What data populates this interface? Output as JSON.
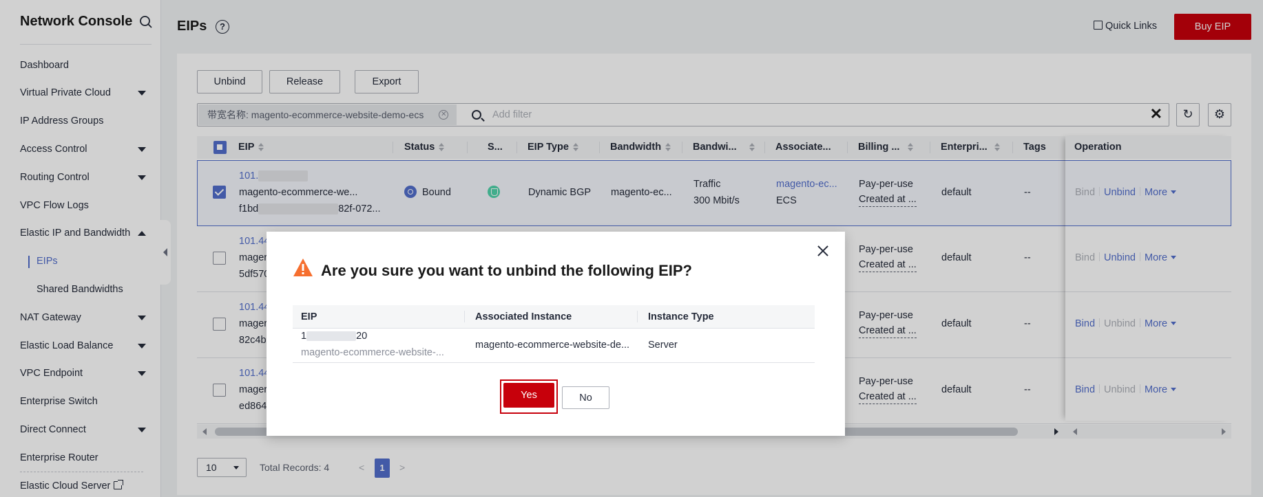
{
  "sidebar": {
    "title": "Network Console",
    "items": [
      {
        "label": "Dashboard"
      },
      {
        "label": "Virtual Private Cloud"
      },
      {
        "label": "IP Address Groups"
      },
      {
        "label": "Access Control"
      },
      {
        "label": "Routing Control"
      },
      {
        "label": "VPC Flow Logs"
      },
      {
        "label": "Elastic IP and Bandwidth"
      },
      {
        "label": "EIPs"
      },
      {
        "label": "Shared Bandwidths"
      },
      {
        "label": "NAT Gateway"
      },
      {
        "label": "Elastic Load Balance"
      },
      {
        "label": "VPC Endpoint"
      },
      {
        "label": "Enterprise Switch"
      },
      {
        "label": "Direct Connect"
      },
      {
        "label": "Enterprise Router"
      },
      {
        "label": "Elastic Cloud Server"
      }
    ]
  },
  "header": {
    "title": "EIPs",
    "help": "?",
    "quick_links": "Quick Links",
    "buy_label": "Buy EIP"
  },
  "toolbar": {
    "unbind": "Unbind",
    "release": "Release",
    "export": "Export",
    "filter_chip": "带宽名称: magento-ecommerce-website-demo-ecs",
    "filter_placeholder": "Add filter",
    "clear": "✕",
    "refresh": "↻",
    "settings": "⚙"
  },
  "table": {
    "columns": [
      "EIP",
      "Status",
      "S...",
      "EIP Type",
      "Bandwidth",
      "Bandwi...",
      "Associate...",
      "Billing ...",
      "Enterpri...",
      "Tags",
      "Operation"
    ],
    "rows": [
      {
        "eip": "101.",
        "name": "magento-ecommerce-we...",
        "id_start": "f1bd",
        "id_end": "82f-072...",
        "status": "Bound",
        "type": "Dynamic BGP",
        "bandwidth": "magento-ec...",
        "bw_line1": "Traffic",
        "bw_line2": "300 Mbit/s",
        "assoc_line1": "magento-ec...",
        "assoc_line2": "ECS",
        "billing_line1": "Pay-per-use",
        "billing_line2": "Created at ...",
        "enterprise": "default",
        "tags": "--",
        "op_bind": "Bind",
        "op_unbind": "Unbind",
        "op_more": "More"
      },
      {
        "eip": "101.44",
        "name": "mager",
        "id_start": "5df570",
        "billing_line1": "Pay-per-use",
        "billing_line2": "Created at ...",
        "enterprise": "default",
        "tags": "--",
        "op_bind": "Bind",
        "op_unbind": "Unbind",
        "op_more": "More"
      },
      {
        "eip": "101.44",
        "name": "mager",
        "id_start": "82c4b",
        "billing_line1": "Pay-per-use",
        "billing_line2": "Created at ...",
        "enterprise": "default",
        "tags": "--",
        "op_bind": "Bind",
        "op_unbind": "Unbind",
        "op_more": "More"
      },
      {
        "eip": "101.44",
        "name": "mager",
        "id_start": "ed864",
        "billing_line1": "Pay-per-use",
        "billing_line2": "Created at ...",
        "enterprise": "default",
        "tags": "--",
        "op_bind": "Bind",
        "op_unbind": "Unbind",
        "op_more": "More"
      }
    ]
  },
  "pagination": {
    "page_size": "10",
    "total": "Total Records: 4",
    "prev": "<",
    "current": "1",
    "next": ">"
  },
  "dialog": {
    "title": "Are you sure you want to unbind the following EIP?",
    "columns": [
      "EIP",
      "Associated Instance",
      "Instance Type"
    ],
    "row": {
      "eip_start": "1",
      "eip_end": "20",
      "eip_name": "magento-ecommerce-website-...",
      "instance": "magento-ecommerce-website-de...",
      "instance_type": "Server"
    },
    "yes_label": "Yes",
    "no_label": "No"
  },
  "colors": {
    "brand_red": "#c7000b",
    "accent_blue": "#526ecc",
    "warning_orange": "#f66f2f"
  }
}
